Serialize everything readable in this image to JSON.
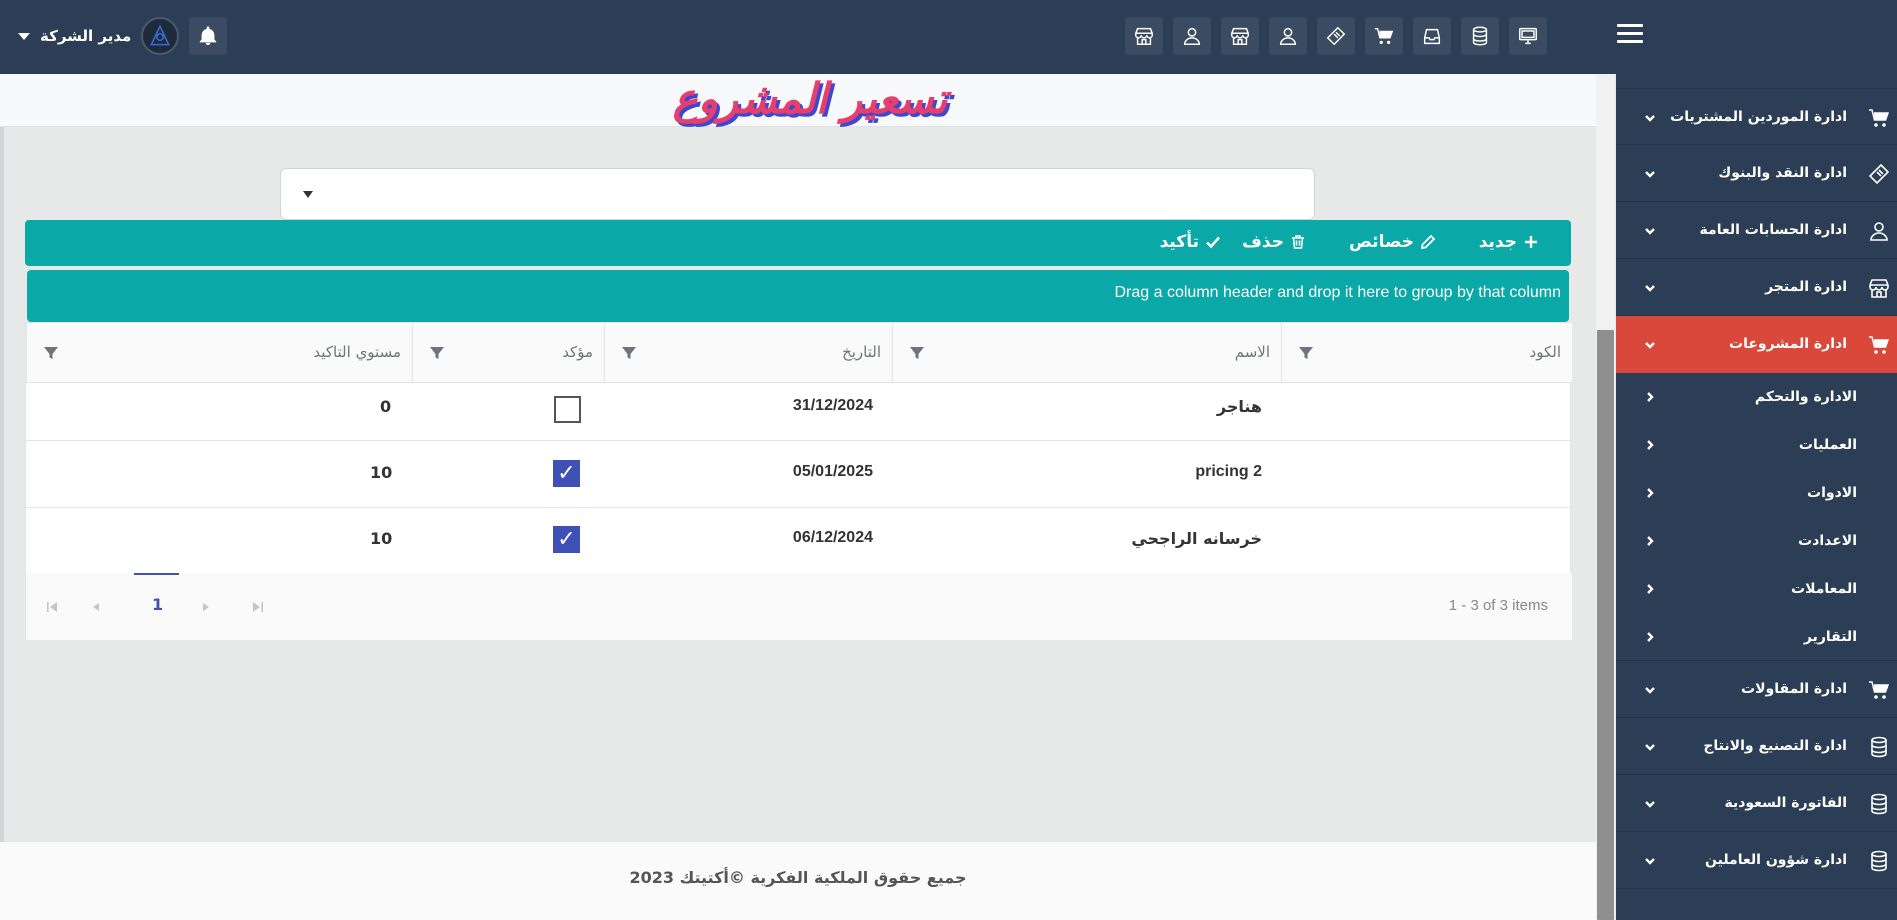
{
  "topbar": {
    "user_name": "مدير الشركة",
    "icons": [
      "monitor-icon",
      "database-icon",
      "inbox-icon",
      "cart-icon",
      "ticket-icon",
      "user-icon",
      "store-icon",
      "user-icon",
      "store-icon"
    ]
  },
  "sidebar": {
    "items": [
      {
        "label": "ادارة الموردين المشتريات",
        "icon": "cart-icon"
      },
      {
        "label": "ادارة النقد والبنوك",
        "icon": "ticket-icon"
      },
      {
        "label": "ادارة الحسابات العامة",
        "icon": "user-icon"
      },
      {
        "label": "ادارة المتجر",
        "icon": "store-icon"
      },
      {
        "label": "ادارة المشروعات",
        "icon": "cart-icon",
        "active": true
      },
      {
        "label": "ادارة المقاولات",
        "icon": "cart-icon"
      },
      {
        "label": "ادارة التصنيع والانتاج",
        "icon": "database-icon"
      },
      {
        "label": "الفاتورة السعودية",
        "icon": "database-icon"
      },
      {
        "label": "ادارة شؤون العاملين",
        "icon": "database-icon"
      }
    ],
    "subitems": [
      "الادارة والتحكم",
      "العمليات",
      "الادوات",
      "الاعدادت",
      "المعاملات",
      "التقارير"
    ]
  },
  "page": {
    "title": "تسعير المشروع"
  },
  "toolbar": {
    "new_label": "جديد",
    "props_label": "خصائص",
    "delete_label": "حذف",
    "confirm_label": "تأكيد"
  },
  "grid": {
    "group_hint": "Drag a column header and drop it here to group by that column",
    "columns": [
      "الكود",
      "الاسم",
      "التاريخ",
      "مؤكد",
      "مستوي التاكيد"
    ],
    "rows": [
      {
        "code": "",
        "name": "هناجر",
        "date": "31/12/2024",
        "confirmed": false,
        "level": "0"
      },
      {
        "code": "",
        "name": "pricing 2",
        "date": "05/01/2025",
        "confirmed": true,
        "level": "10"
      },
      {
        "code": "",
        "name": "خرسانه الراجحي",
        "date": "06/12/2024",
        "confirmed": true,
        "level": "10"
      }
    ],
    "pager": {
      "current_page": "1",
      "info": "1 - 3 of 3 items"
    }
  },
  "footer": {
    "text": "جميع حقوق الملكية الفكرية ©أكتيتك 2023"
  },
  "colors": {
    "navy": "#2c3e55",
    "teal": "#0aa9a7",
    "active": "#d9483b",
    "checkbox": "#3f51b5",
    "title": "#e63e6d"
  }
}
